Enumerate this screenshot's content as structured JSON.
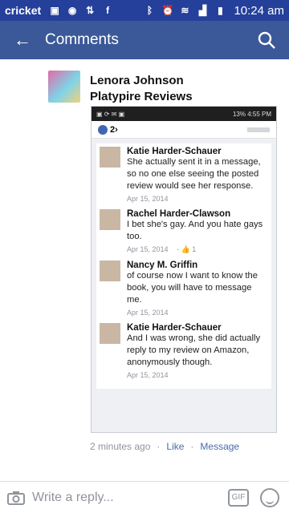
{
  "status": {
    "carrier": "cricket",
    "time": "10:24 am"
  },
  "appbar": {
    "title": "Comments"
  },
  "comment": {
    "author_line1": "Lenora Johnson",
    "author_line2": "Platypire Reviews",
    "timestamp": "2 minutes ago",
    "like_label": "Like",
    "message_label": "Message"
  },
  "screenshot": {
    "status_right": "13% 4:55 PM",
    "like_count": "2",
    "comments": [
      {
        "name": "Katie Harder-Schauer",
        "text": "She actually sent it in a message, so no one else seeing the posted review would see her response.",
        "date": "Apr 15, 2014"
      },
      {
        "name": "Rachel Harder-Clawson",
        "text": "I bet she's gay. And you hate gays too.",
        "date": "Apr 15, 2014",
        "likes": "1"
      },
      {
        "name": "Nancy M. Griffin",
        "text": "of course now I want to know the book, you will have to message me.",
        "date": "Apr 15, 2014"
      },
      {
        "name": "Katie Harder-Schauer",
        "text": "And I was wrong, she did actually reply to my review on Amazon, anonymously though.",
        "date": "Apr 15, 2014"
      }
    ]
  },
  "composer": {
    "placeholder": "Write a reply...",
    "gif_label": "GIF"
  }
}
